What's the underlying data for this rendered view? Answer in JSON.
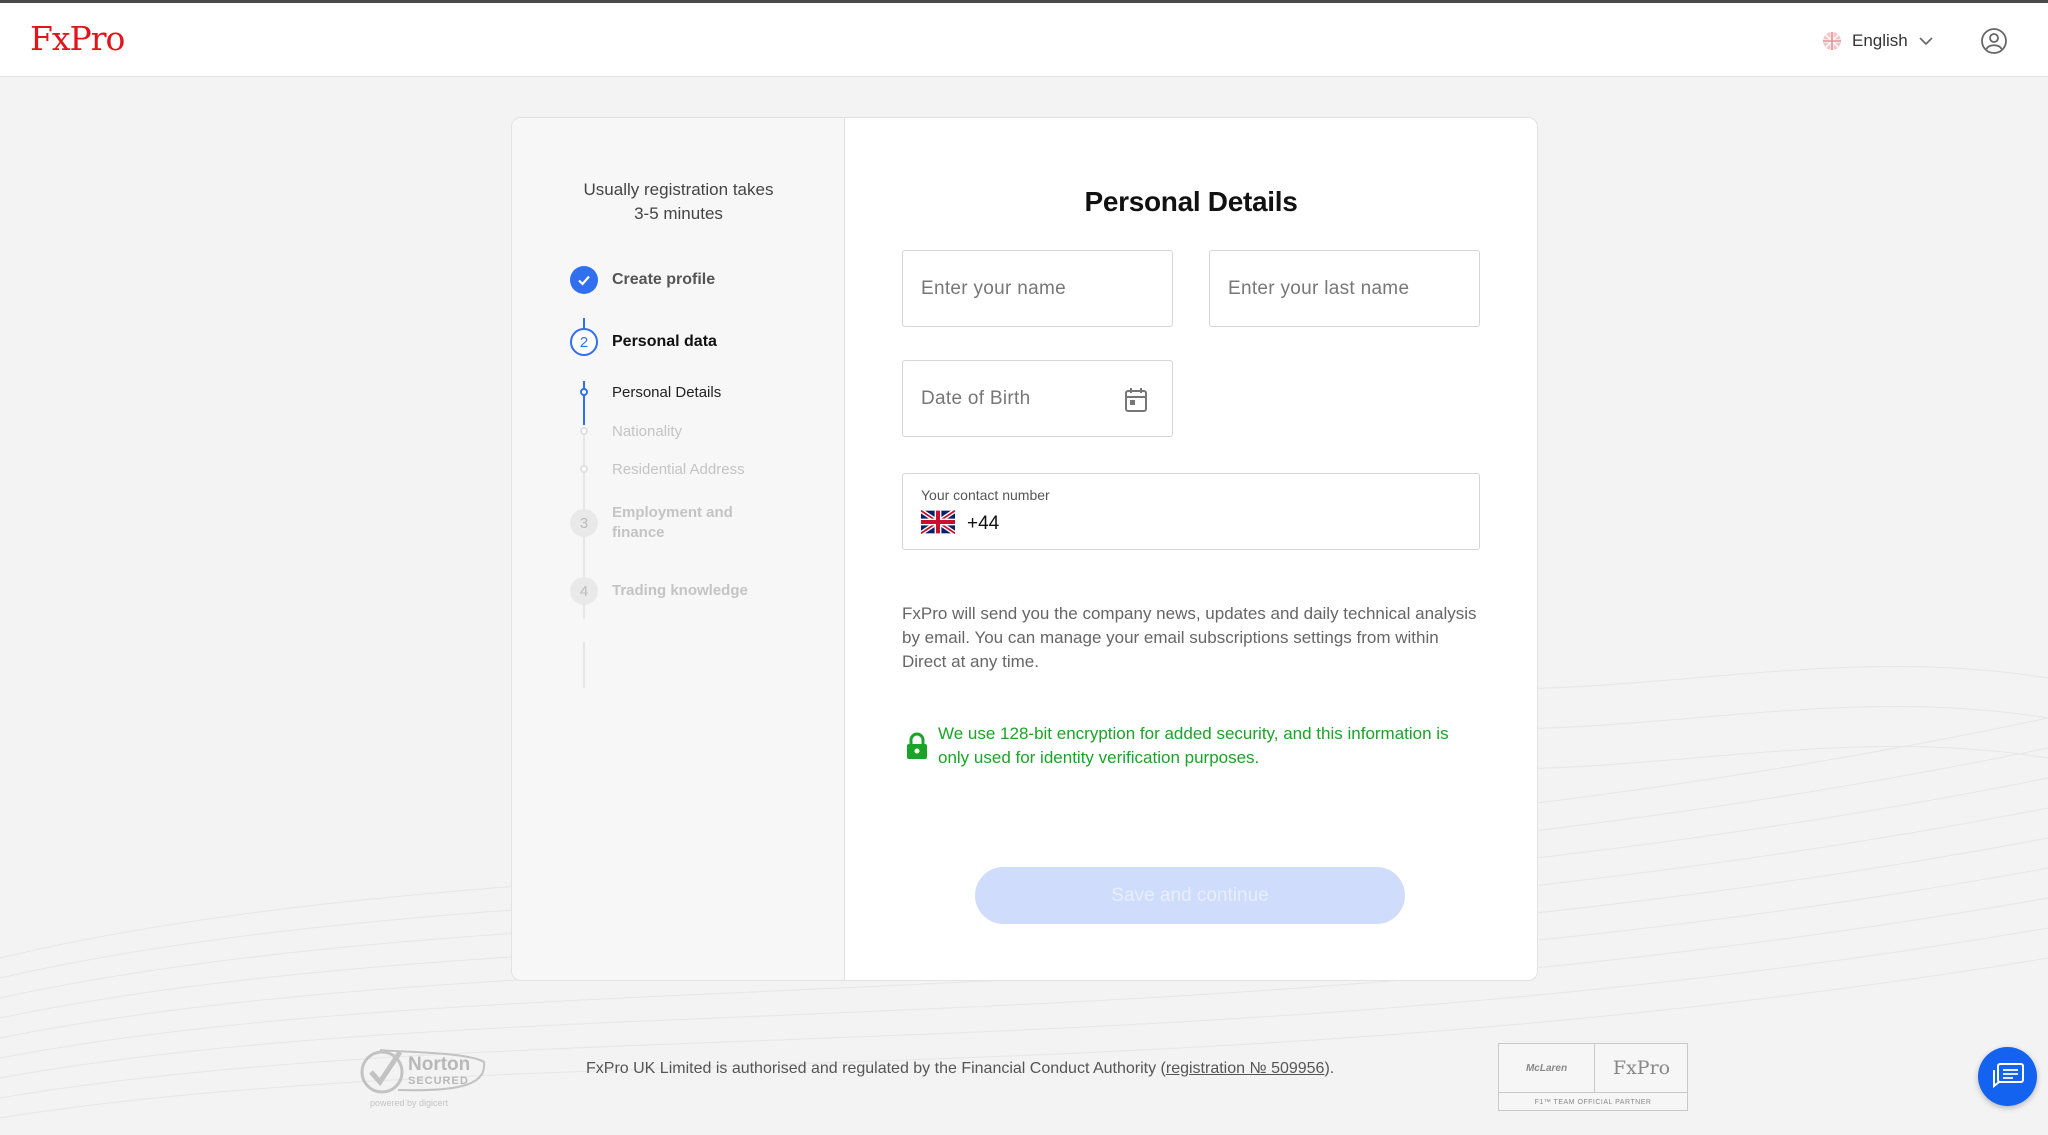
{
  "header": {
    "logo": "FxPro",
    "language": "English",
    "language_icon": "globe-icon",
    "user_icon": "user-circle-icon"
  },
  "sidebar": {
    "note_line1": "Usually registration takes",
    "note_line2": "3-5 minutes",
    "steps": [
      {
        "number": "1",
        "label": "Create profile",
        "state": "completed"
      },
      {
        "number": "2",
        "label": "Personal data",
        "state": "active"
      },
      {
        "number": "3",
        "label": "Employment and finance",
        "state": "pending"
      },
      {
        "number": "4",
        "label": "Trading knowledge",
        "state": "pending"
      }
    ],
    "substeps": [
      {
        "label": "Personal Details",
        "state": "active"
      },
      {
        "label": "Nationality",
        "state": "pending"
      },
      {
        "label": "Residential Address",
        "state": "pending"
      }
    ],
    "step3_line1": "Employment and",
    "step3_line2": "finance"
  },
  "form": {
    "title": "Personal Details",
    "first_name_placeholder": "Enter your name",
    "last_name_placeholder": "Enter your last name",
    "dob_placeholder": "Date of Birth",
    "phone_label": "Your contact number",
    "phone_code": "+44",
    "info": "FxPro will send you the company news, updates and daily technical analysis by email. You can manage your email subscriptions settings from within Direct at any time.",
    "security": "We use 128-bit encryption for added security, and this information is only used for identity verification purposes.",
    "submit": "Save and continue"
  },
  "footer": {
    "text_before": "FxPro UK Limited is authorised and regulated by the Financial Conduct Authority (",
    "link": "registration № 509956",
    "text_after": ").",
    "norton_line1": "Norton",
    "norton_line2": "SECURED",
    "norton_line3": "powered by digicert",
    "partner_left": "McLaren",
    "partner_right": "FxPro",
    "partner_caption": "F1™ TEAM OFFICIAL PARTNER"
  },
  "colors": {
    "brand_red": "#e0161b",
    "accent_blue": "#2f6ff0",
    "success_green": "#1aa428",
    "disabled_button": "#cfdcfb"
  }
}
